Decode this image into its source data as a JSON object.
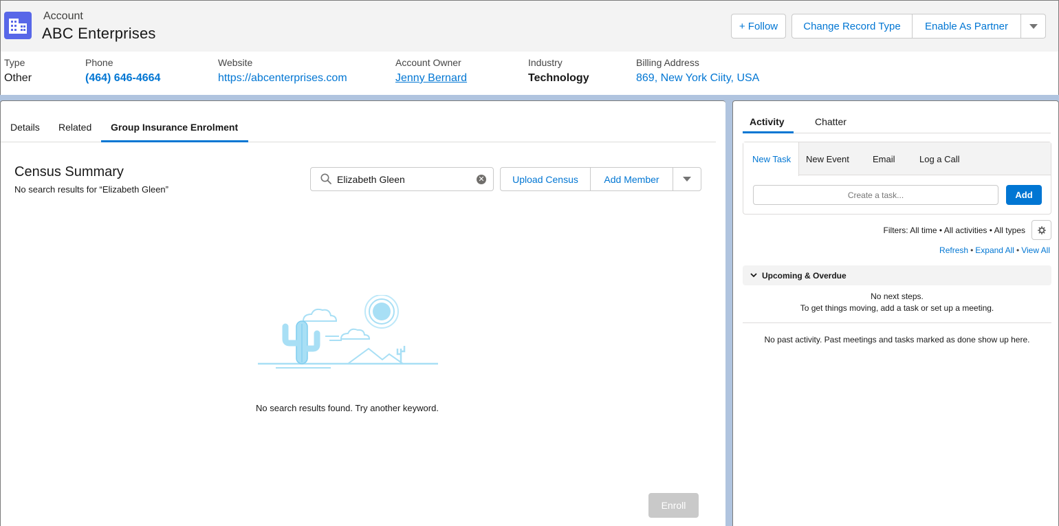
{
  "header": {
    "object_label": "Account",
    "record_title": "ABC Enterprises",
    "buttons": {
      "follow": "+ Follow",
      "change_record_type": "Change Record Type",
      "enable_as_partner": "Enable As Partner"
    },
    "fields": [
      {
        "label": "Type",
        "value": "Other"
      },
      {
        "label": "Phone",
        "value": "(464) 646-4664"
      },
      {
        "label": "Website",
        "value": "https://abcenterprises.com"
      },
      {
        "label": "Account Owner",
        "value": "Jenny Bernard"
      },
      {
        "label": "Industry",
        "value": "Technology"
      },
      {
        "label": "Billing Address",
        "value": "869, New York Ciity, USA"
      }
    ]
  },
  "main": {
    "tabs": [
      "Details",
      "Related",
      "Group Insurance Enrolment"
    ],
    "active_tab": "Group Insurance Enrolment",
    "census": {
      "title": "Census Summary",
      "subtitle": "No search results for “Elizabeth Gleen”",
      "search_value": "Elizabeth Gleen",
      "upload_label": "Upload Census",
      "add_member_label": "Add Member",
      "empty_message": "No search results found. Try another keyword.",
      "enroll_label": "Enroll"
    }
  },
  "activity": {
    "tabs": [
      "Activity",
      "Chatter"
    ],
    "composer_tabs": [
      "New Task",
      "New Event",
      "Email",
      "Log a Call"
    ],
    "task_placeholder": "Create a task...",
    "add_label": "Add",
    "filters": "Filters: All time • All activities • All types",
    "links": [
      "Refresh",
      "Expand All",
      "View All"
    ],
    "upcoming_title": "Upcoming & Overdue",
    "no_next_steps": "No next steps.",
    "next_steps_hint": "To get things moving, add a task or set up a meeting.",
    "no_past_activity": "No past activity. Past meetings and tasks marked as done show up here."
  },
  "colors": {
    "brand_blue": "#0176d3",
    "account_icon": "#5867e8",
    "page_background": "#b0c4df"
  },
  "icons": [
    "account-icon",
    "search-icon",
    "clear-icon",
    "chevron-down-icon",
    "gear-icon",
    "desert-illustration"
  ]
}
